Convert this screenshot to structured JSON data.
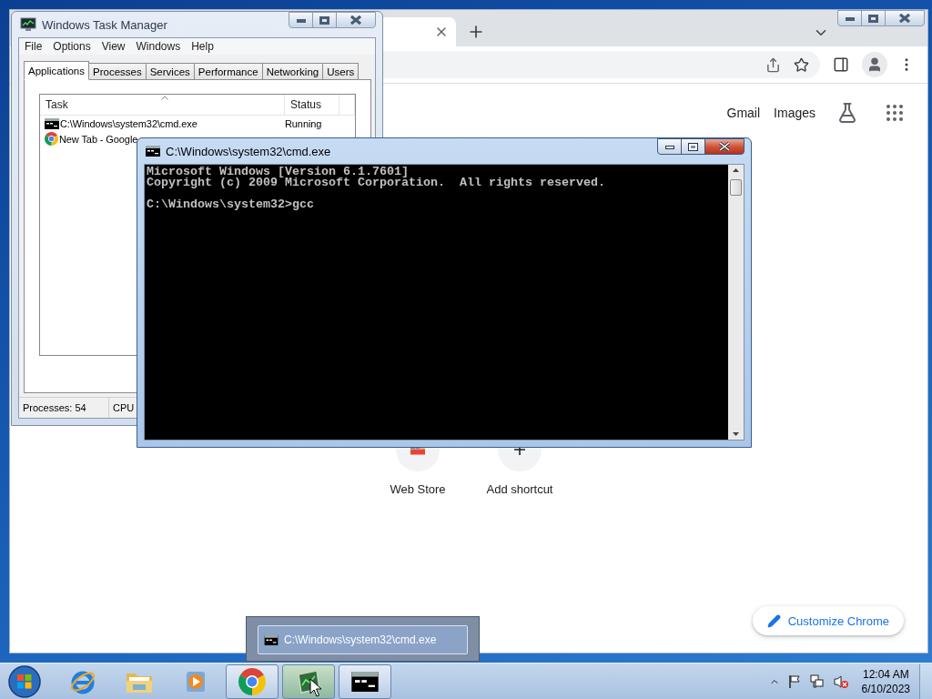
{
  "chrome": {
    "active": false,
    "top_links": [
      "Gmail",
      "Images"
    ],
    "shortcuts": [
      {
        "kind": "webstore",
        "label": "Web Store"
      },
      {
        "kind": "add",
        "label": "Add shortcut"
      }
    ],
    "customize_button": "Customize Chrome"
  },
  "task_manager": {
    "title": "Windows Task Manager",
    "active": false,
    "menu": [
      "File",
      "Options",
      "View",
      "Windows",
      "Help"
    ],
    "tabs": [
      {
        "label": "Applications",
        "selected": true
      },
      {
        "label": "Processes",
        "selected": false
      },
      {
        "label": "Services",
        "selected": false
      },
      {
        "label": "Performance",
        "selected": false
      },
      {
        "label": "Networking",
        "selected": false
      },
      {
        "label": "Users",
        "selected": false
      }
    ],
    "columns": [
      "Task",
      "Status"
    ],
    "rows": [
      {
        "kind": "cmd",
        "task": "C:\\Windows\\system32\\cmd.exe",
        "status": "Running"
      },
      {
        "kind": "chrome",
        "task": "New Tab - Google"
      }
    ],
    "status_bar": [
      "Processes: 54",
      "CPU"
    ]
  },
  "cmd": {
    "title": "C:\\Windows\\system32\\cmd.exe",
    "active": true,
    "output": [
      "Microsoft Windows [Version 6.1.7601]",
      "Copyright (c) 2009 Microsoft Corporation.  All rights reserved."
    ],
    "prompt": "C:\\Windows\\system32>gcc"
  },
  "taskbar": {
    "buttons": [
      {
        "kind": "ie",
        "running": false,
        "hovered": false
      },
      {
        "kind": "explorer",
        "running": false,
        "hovered": false
      },
      {
        "kind": "media",
        "running": false,
        "hovered": false
      },
      {
        "kind": "chrome",
        "running": true,
        "hovered": false
      },
      {
        "kind": "taskmgr",
        "running": true,
        "hovered": true
      },
      {
        "kind": "cmd",
        "running": true,
        "hovered": false
      }
    ],
    "thumbnail": {
      "kind": "cmd",
      "title": "C:\\Windows\\system32\\cmd.exe"
    },
    "clock": {
      "time": "12:04 AM",
      "date": "6/10/2023"
    }
  }
}
